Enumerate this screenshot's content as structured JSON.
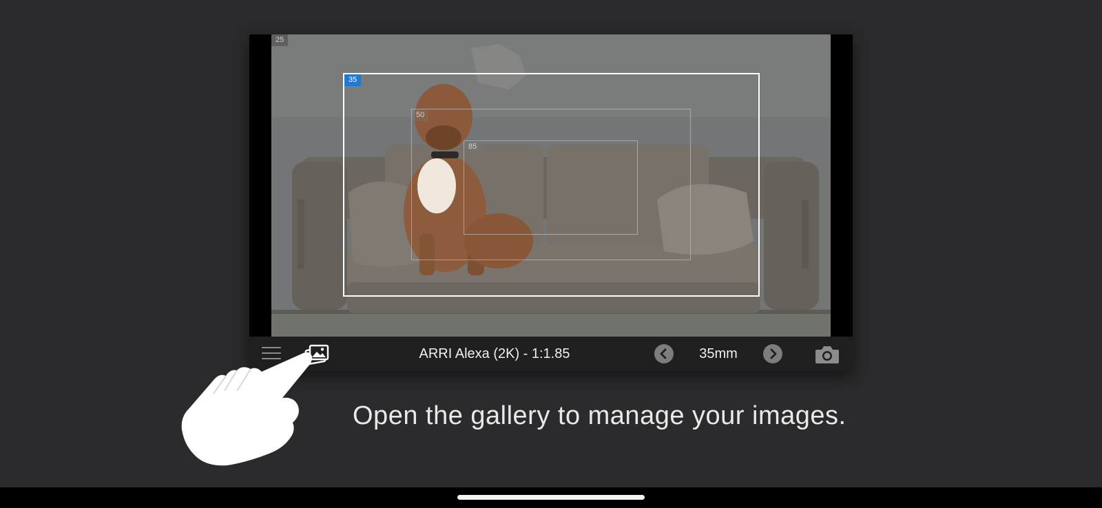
{
  "viewer": {
    "frame_labels": {
      "f25": "25",
      "f35": "35",
      "f50": "50",
      "f85": "85"
    },
    "active_frame": "35"
  },
  "toolbar": {
    "menu_icon": "menu-icon",
    "gallery_icon": "gallery-icon",
    "camera_title": "ARRI Alexa (2K) - 1:1.85",
    "prev_icon": "chevron-left-icon",
    "focal_length": "35mm",
    "next_icon": "chevron-right-icon",
    "capture_icon": "camera-icon"
  },
  "instruction": {
    "text": "Open the gallery to manage your images."
  },
  "colors": {
    "background": "#2b2b2d",
    "toolbar": "#1f1f20",
    "active_frame_label": "#1f7ad6",
    "text": "#f0f0f0"
  }
}
